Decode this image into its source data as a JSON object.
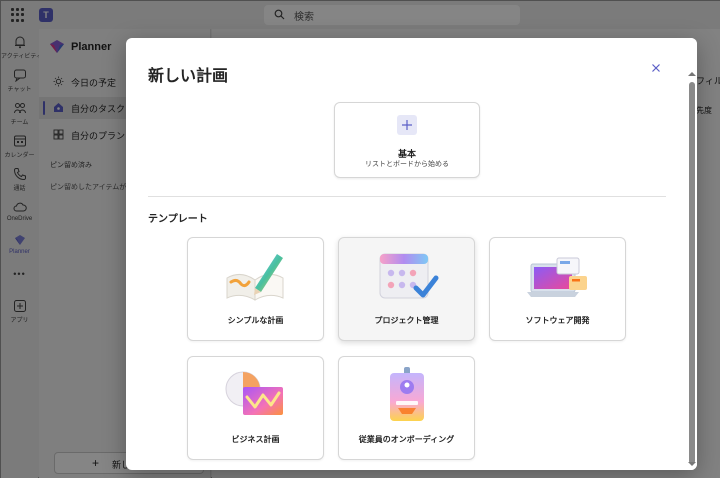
{
  "topbar": {
    "search_placeholder": "検索"
  },
  "rail": {
    "items": [
      {
        "label": "アクティビティ",
        "icon": "bell-icon"
      },
      {
        "label": "チャット",
        "icon": "chat-icon"
      },
      {
        "label": "チーム",
        "icon": "teams-icon"
      },
      {
        "label": "カレンダー",
        "icon": "calendar-icon"
      },
      {
        "label": "通話",
        "icon": "phone-icon"
      },
      {
        "label": "OneDrive",
        "icon": "cloud-icon"
      },
      {
        "label": "Planner",
        "icon": "planner-icon"
      },
      {
        "label": "アプリ",
        "icon": "apps-icon"
      }
    ],
    "more": "•••"
  },
  "leftpane": {
    "title": "Planner",
    "nav": [
      {
        "label": "今日の予定",
        "icon": "sun-icon"
      },
      {
        "label": "自分のタスク",
        "icon": "home-icon"
      },
      {
        "label": "自分のプラン",
        "icon": "grid-icon"
      }
    ],
    "pinned_heading": "ピン留め済み",
    "pinned_desc": "ピン留めしたアイテムがこ",
    "new_plan_label": "新しい"
  },
  "main": {
    "filter_label": "フィル",
    "sort_label": "先度"
  },
  "dialog": {
    "title": "新しい計画",
    "blank": {
      "name": "基本",
      "subtitle": "リストとボードから始める"
    },
    "section_label": "テンプレート",
    "templates": [
      {
        "name": "シンプルな計画"
      },
      {
        "name": "プロジェクト管理"
      },
      {
        "name": "ソフトウェア開発"
      },
      {
        "name": "ビジネス計画"
      },
      {
        "name": "従業員のオンボーディング"
      }
    ]
  },
  "colors": {
    "accent": "#5b5fc7",
    "overlay": "rgba(0,0,0,0.48)"
  }
}
